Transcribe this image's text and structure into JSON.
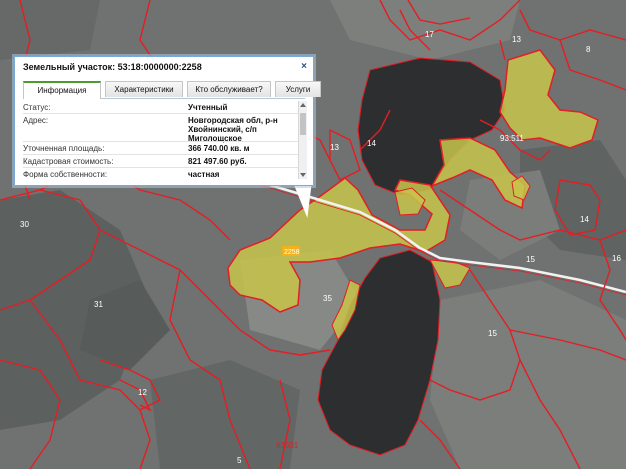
{
  "popup": {
    "title": "Земельный участок: 53:18:0000000:2258",
    "close_glyph": "×",
    "tabs": [
      {
        "label": "Информация",
        "active": true
      },
      {
        "label": "Характеристики",
        "active": false
      },
      {
        "label": "Кто обслуживает?",
        "active": false
      },
      {
        "label": "Услуги",
        "active": false
      }
    ],
    "rows": [
      {
        "key": "Статус:",
        "value": "Учтенный"
      },
      {
        "key": "Адрес:",
        "value": "Новгородская обл, р-н Хвойнинский, с/п Миголощское"
      },
      {
        "key": "Уточненная площадь:",
        "value": "366 740.00 кв. м"
      },
      {
        "key": "Кадастровая стоимость:",
        "value": "821 497.60 руб."
      },
      {
        "key": "Форма собственности:",
        "value": "частная"
      }
    ]
  },
  "map": {
    "colors": {
      "terrain": "#6f7270",
      "forest": "#5c605e",
      "field": "#8f928f",
      "lake": "#2d2e2f",
      "parcel_fill": "#c8c44a",
      "boundary": "#e31e24",
      "road": "#f2f2f2",
      "label_on_parcel_bg": "#f2b21c"
    },
    "labels": [
      {
        "text": "17"
      },
      {
        "text": "13"
      },
      {
        "text": "8"
      },
      {
        "text": "93:511"
      },
      {
        "text": "13"
      },
      {
        "text": "14"
      },
      {
        "text": "14"
      },
      {
        "text": "15"
      },
      {
        "text": "16"
      },
      {
        "text": "30"
      },
      {
        "text": "31"
      },
      {
        "text": "2258"
      },
      {
        "text": "35"
      },
      {
        "text": "15"
      },
      {
        "text": "12"
      },
      {
        "text": "93501"
      },
      {
        "text": "5"
      }
    ]
  }
}
